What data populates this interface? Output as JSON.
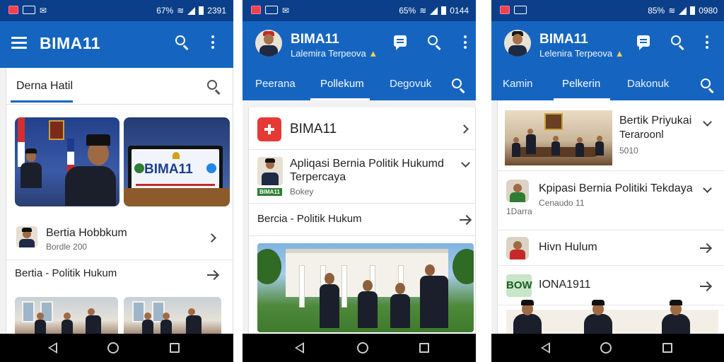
{
  "screens": [
    {
      "status": {
        "time": "2391",
        "battery": "67%"
      },
      "app_title": "BIMA11",
      "search_tab_label": "Derna Hatil",
      "news_row": {
        "title": "Bertia Hobbkum",
        "subtitle": "Bordle 200"
      },
      "category_row": {
        "label": "Bertia - Politik Hukum"
      },
      "thumb_screen_text": "BIMA11"
    },
    {
      "status": {
        "time": "0144",
        "battery": "65%"
      },
      "app_title": "BIMA11",
      "app_subtitle": "Lalemira Terpeova",
      "tabs": [
        "Peerana",
        "Pollekum",
        "Degovuk"
      ],
      "active_tab": 1,
      "app_row": {
        "title": "BIMA11"
      },
      "news_row": {
        "title": "Apliqasi Bernia Politik Hukumd Terpercaya",
        "subtitle": "Bokey",
        "tag": "BIMA11"
      },
      "category_row": {
        "label": "Bercia - Politik Hukum"
      }
    },
    {
      "status": {
        "time": "0980",
        "battery": "85%"
      },
      "app_title": "BIMA11",
      "app_subtitle": "Lelenira Terpeova",
      "tabs": [
        "Kamin",
        "Pelkerin",
        "Dakonuk"
      ],
      "active_tab": 1,
      "news_row_1": {
        "title": "Bertik Priyukai",
        "title2": "Teraroonl",
        "subtitle": "5010"
      },
      "news_row_2": {
        "title": "Kpipasi Bernia Politiki Tekdaya",
        "subtitle": "Cenaudo 11",
        "side": "1Darra"
      },
      "row_3": {
        "title": "Hivn Hulum"
      },
      "row_4": {
        "badge": "BOW",
        "title": "IONA1911"
      }
    }
  ]
}
